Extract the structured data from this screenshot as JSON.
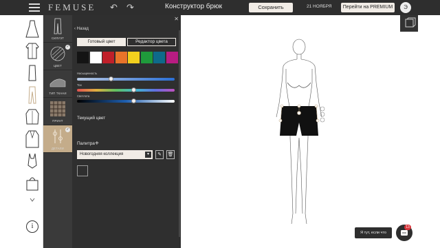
{
  "header": {
    "brand": "FEMUSE",
    "title": "Конструктор брюк",
    "save_label": "Сохранить",
    "date": "21 НОЯБРЯ",
    "premium_label": "Перейти на PREMIUM",
    "avatar_letter": "Э"
  },
  "categories": [
    {
      "label": "СИЛУЭТ"
    },
    {
      "label": "ЦВЕТ"
    },
    {
      "label": "ТИП ТКАНИ"
    },
    {
      "label": "ПРИНТ"
    },
    {
      "label": "ДЕТАЛИ"
    }
  ],
  "panel": {
    "back_label": "Назад",
    "tab_ready": "Готовый цвет",
    "tab_editor": "Редактор цвета",
    "swatches": [
      "#141414",
      "#ffffff",
      "#c0202a",
      "#e8742a",
      "#f2d01e",
      "#1f9a3b",
      "#0e6a8a",
      "#b81c82"
    ],
    "saturation_label": "Насыщенность",
    "saturation_value": 0.35,
    "hue_label": "Тон",
    "hue_value": 0.58,
    "brightness_label": "Светлота",
    "brightness_value": 0.58,
    "current_color_label": "Текущий цвет",
    "palette_label": "Палитра",
    "collection_value": "Новогодняя коллекция"
  },
  "chat": {
    "bubble_text": "Я тут, если что",
    "badge_count": "13"
  },
  "colors": {
    "topbar": "#2e2e2e",
    "panel": "#2f2f2f",
    "accent": "#c4ac8a",
    "button_bg": "#f1ece6"
  }
}
